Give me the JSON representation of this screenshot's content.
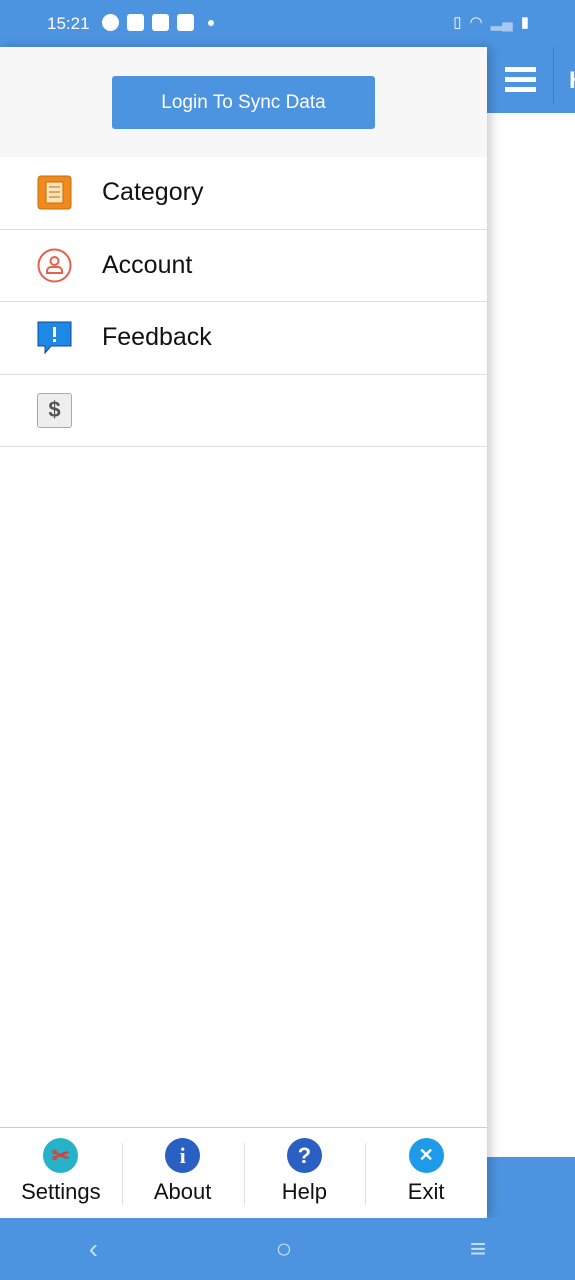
{
  "status_bar": {
    "time": "15:21"
  },
  "main": {
    "title_partial": "H"
  },
  "drawer": {
    "login_button": "Login To Sync Data",
    "items": [
      {
        "label": "Category",
        "icon": "category-icon"
      },
      {
        "label": "Account",
        "icon": "account-icon"
      },
      {
        "label": "Feedback",
        "icon": "feedback-icon"
      },
      {
        "label": "",
        "icon": "dollar-icon"
      }
    ],
    "footer": [
      {
        "label": "Settings",
        "icon": "settings-icon"
      },
      {
        "label": "About",
        "icon": "info-icon"
      },
      {
        "label": "Help",
        "icon": "help-icon"
      },
      {
        "label": "Exit",
        "icon": "exit-icon"
      }
    ]
  },
  "colors": {
    "accent": "#4d94e0"
  }
}
